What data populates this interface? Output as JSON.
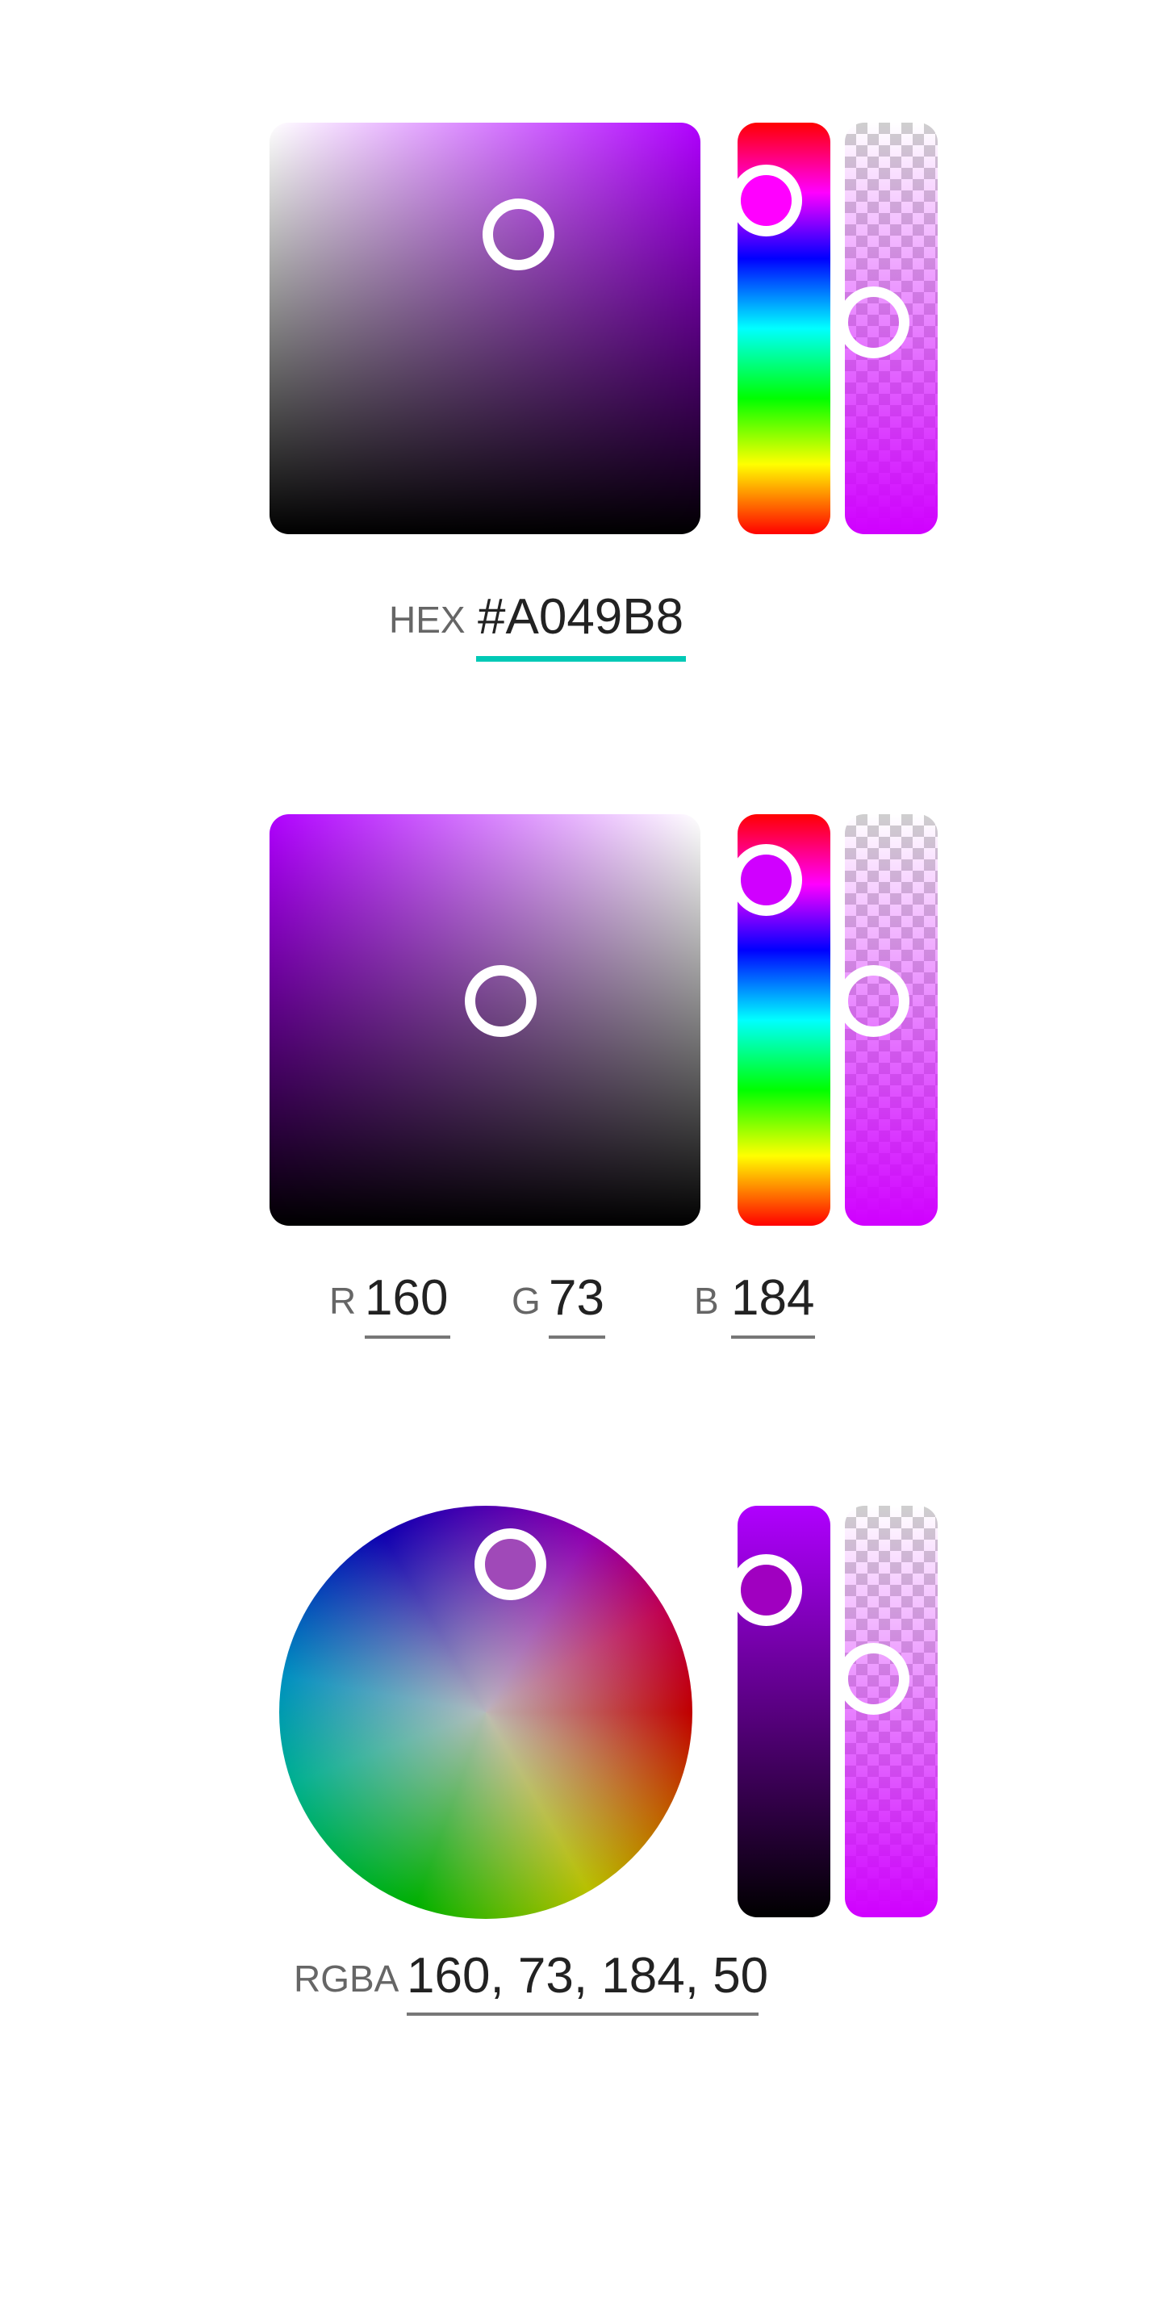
{
  "picker_hex": {
    "label": "HEX",
    "value": "#A049B8",
    "sv_box": {
      "hue_color": "#b000ff"
    },
    "hue_slider": {
      "handle_color": "#ff00ff"
    },
    "alpha_slider": {
      "color": "#d000ff"
    },
    "field_focus_color": "#00c9b6"
  },
  "picker_rgb": {
    "r_label": "R",
    "r_value": "160",
    "g_label": "G",
    "g_value": "73",
    "b_label": "B",
    "b_value": "184",
    "sv_box": {
      "hue_color": "#b000ff"
    }
  },
  "picker_wheel": {
    "label": "RGBA",
    "value": "160, 73, 184, 50",
    "shade_slider": {
      "top_color": "#b000ff",
      "bottom_color": "#000000"
    }
  }
}
